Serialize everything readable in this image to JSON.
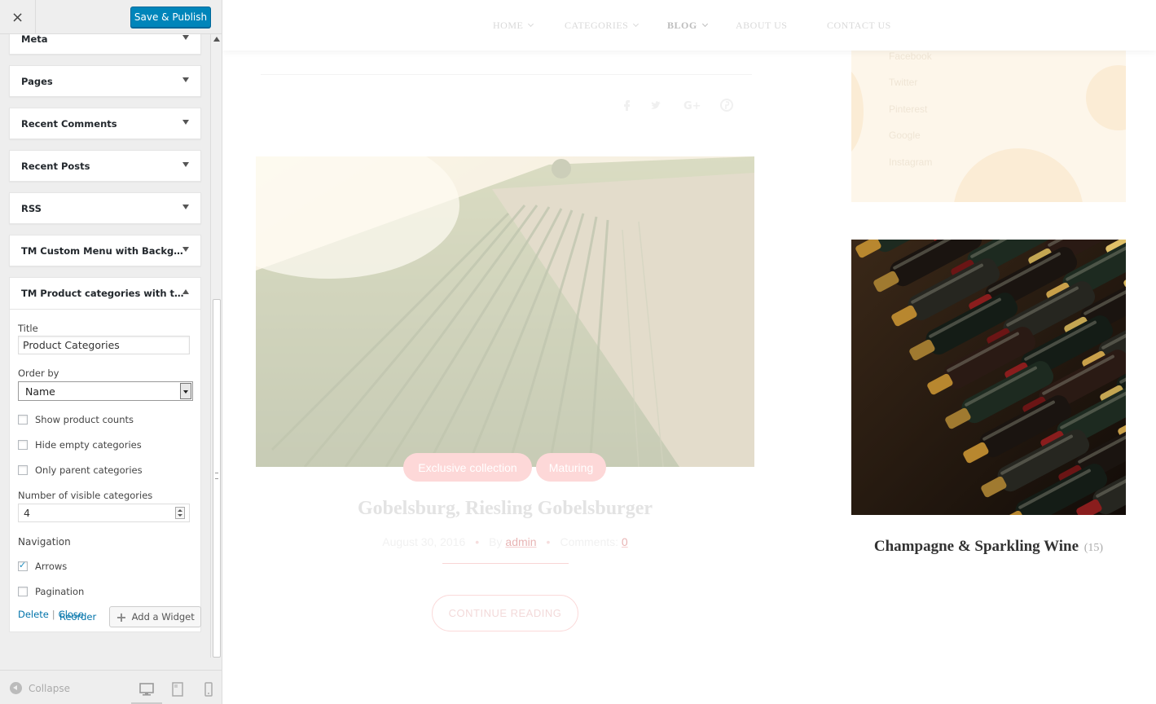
{
  "sidebar": {
    "close_label": "×",
    "publish_label": "Save & Publish",
    "widgets": [
      "Meta",
      "Pages",
      "Recent Comments",
      "Recent Posts",
      "RSS",
      "TM Custom Menu with Backg…"
    ],
    "open_widget": {
      "title": "TM Product categories with t…",
      "title_label": "Title",
      "title_value": "Product Categories",
      "order_label": "Order by",
      "order_value": "Name",
      "options": [
        {
          "label": "Show product counts",
          "checked": false
        },
        {
          "label": "Hide empty categories",
          "checked": false
        },
        {
          "label": "Only parent categories",
          "checked": false
        }
      ],
      "visible_label": "Number of visible categories",
      "visible_value": "4",
      "navigation_label": "Navigation",
      "nav_options": [
        {
          "label": "Arrows",
          "checked": true
        },
        {
          "label": "Pagination",
          "checked": false
        }
      ],
      "delete_label": "Delete",
      "separator": "|",
      "close_label": "Close"
    },
    "reorder_label": "Reorder",
    "add_widget_label": "Add a Widget",
    "collapse_label": "Collapse"
  },
  "preview": {
    "nav": [
      {
        "label": "HOME",
        "dropdown": true
      },
      {
        "label": "CATEGORIES",
        "dropdown": true
      },
      {
        "label": "BLOG",
        "dropdown": true,
        "active": true
      },
      {
        "label": "ABOUT US",
        "dropdown": false
      },
      {
        "label": "CONTACT US",
        "dropdown": false
      }
    ],
    "social_links": [
      "Facebook",
      "Twitter",
      "Pinterest",
      "Google",
      "Instagram"
    ],
    "post": {
      "tags": [
        "Exclusive collection",
        "Maturing"
      ],
      "title": "Gobelsburg, Riesling Gobelsburger",
      "date": "August 30, 2016",
      "by_label": "By",
      "author": "admin",
      "comments_label": "Comments:",
      "comments_count": "0",
      "continue_label": "CONTINUE READING"
    },
    "category": {
      "name": "Champagne & Sparkling Wine",
      "count": "(15)"
    }
  },
  "colors": {
    "accent": "#0085ba",
    "tag": "#fdd8d8"
  }
}
